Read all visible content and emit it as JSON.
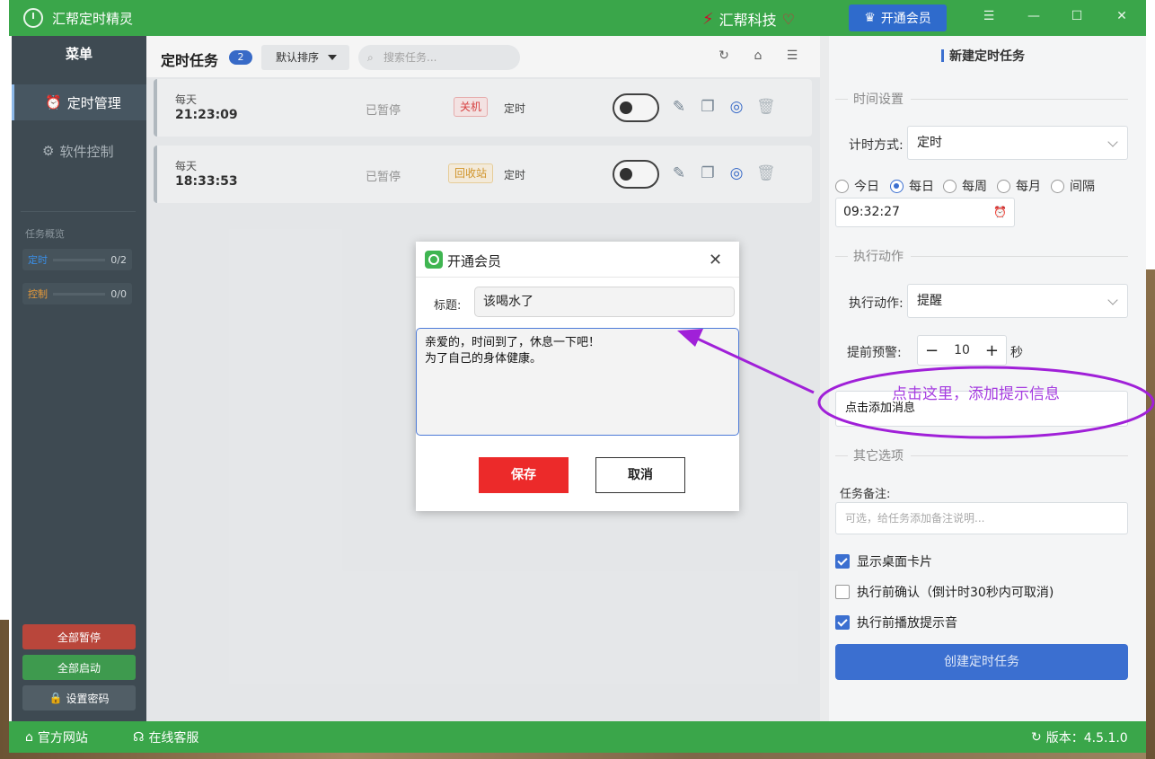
{
  "app": {
    "title": "汇帮定时精灵",
    "brand": "汇帮科技",
    "vip_button": "开通会员"
  },
  "sidebar": {
    "header": "菜单",
    "items": [
      {
        "label": "定时管理"
      },
      {
        "label": "软件控制"
      }
    ],
    "overview_title": "任务概览",
    "overview": [
      {
        "label": "定时",
        "count": "0/2",
        "color": "#3a8ee6"
      },
      {
        "label": "控制",
        "count": "0/0",
        "color": "#e69a3a"
      }
    ],
    "buttons": {
      "pause_all": "全部暂停",
      "start_all": "全部启动",
      "set_password": "设置密码"
    }
  },
  "main": {
    "title": "定时任务",
    "count": "2",
    "sort_label": "默认排序",
    "search_placeholder": "搜索任务...",
    "tasks": [
      {
        "repeat": "每天",
        "time": "21:23:09",
        "status": "已暂停",
        "action_tag": "关机",
        "type": "定时",
        "enabled": false
      },
      {
        "repeat": "每天",
        "time": "18:33:53",
        "status": "已暂停",
        "action_tag": "回收站",
        "type": "定时",
        "enabled": false
      }
    ]
  },
  "right": {
    "title": "新建定时任务",
    "section_time": "时间设置",
    "timing_label": "计时方式:",
    "timing_value": "定时",
    "freq_options": [
      {
        "label": "今日",
        "selected": false
      },
      {
        "label": "每日",
        "selected": true
      },
      {
        "label": "每周",
        "selected": false
      },
      {
        "label": "每月",
        "selected": false
      },
      {
        "label": "间隔",
        "selected": false
      }
    ],
    "time_value": "09:32:27",
    "section_action": "执行动作",
    "action_label": "执行动作:",
    "action_value": "提醒",
    "advance_label": "提前预警:",
    "advance_value": "10",
    "advance_unit": "秒",
    "message_placeholder": "点击添加消息",
    "section_other": "其它选项",
    "note_label": "任务备注:",
    "note_placeholder": "可选，给任务添加备注说明...",
    "options": [
      {
        "label": "显示桌面卡片",
        "checked": true
      },
      {
        "label": "执行前确认（倒计时30秒内可取消)",
        "checked": false
      },
      {
        "label": "执行前播放提示音",
        "checked": true
      }
    ],
    "create_button": "创建定时任务"
  },
  "footer": {
    "website": "官方网站",
    "support": "在线客服",
    "version": "版本：4.5.1.0"
  },
  "dialog": {
    "title": "开通会员",
    "title_label": "标题:",
    "title_value": "该喝水了",
    "message": "亲爱的，时间到了，休息一下吧！\n为了自己的身体健康。",
    "save": "保存",
    "cancel": "取消"
  },
  "annotation": {
    "text": "点击这里，添加提示信息",
    "color": "#a53ce0"
  }
}
